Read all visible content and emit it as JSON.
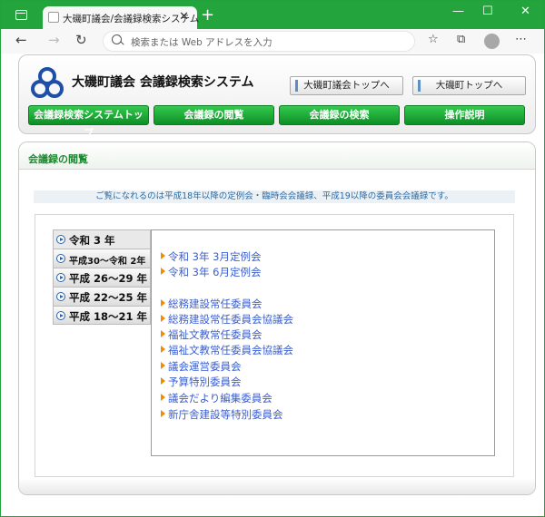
{
  "browser": {
    "tab_title": "大磯町議会/会議録検索システム",
    "tab_close": "✕",
    "new_tab": "+",
    "address_placeholder": "検索または Web アドレスを入力",
    "window_controls": [
      "—",
      "☐",
      "✕"
    ]
  },
  "header": {
    "site_title": "大磯町議会  会議録検索システム",
    "link_council_top": "大磯町議会トップへ",
    "link_town_top": "大磯町トップへ"
  },
  "nav": {
    "items": [
      "会議録検索システムトップ",
      "会議録の閲覧",
      "会議録の検索",
      "操作説明"
    ]
  },
  "main": {
    "section_title": "会議録の閲覧",
    "notice": "ご覧になれるのは平成18年以降の定例会・臨時会会議録、平成19以降の委員会会議録です。",
    "years": [
      "令和  3 年",
      "平成30～令和 2年",
      "平成 26～29 年",
      "平成 22～25 年",
      "平成 18～21 年"
    ],
    "meetings": {
      "plenary": [
        "令和 3年 3月定例会",
        "令和 3年 6月定例会"
      ],
      "committees": [
        "総務建設常任委員会",
        "総務建設常任委員会協議会",
        "福祉文教常任委員会",
        "福祉文教常任委員会協議会",
        "議会運営委員会",
        "予算特別委員会",
        "議会だより編集委員会",
        "新庁舎建設等特別委員会"
      ]
    }
  },
  "colors": {
    "window_frame": "#1fa33a",
    "nav_button": "#0d8f26",
    "link_blue": "#3a5fd0",
    "section_green": "#1a8a2e"
  }
}
